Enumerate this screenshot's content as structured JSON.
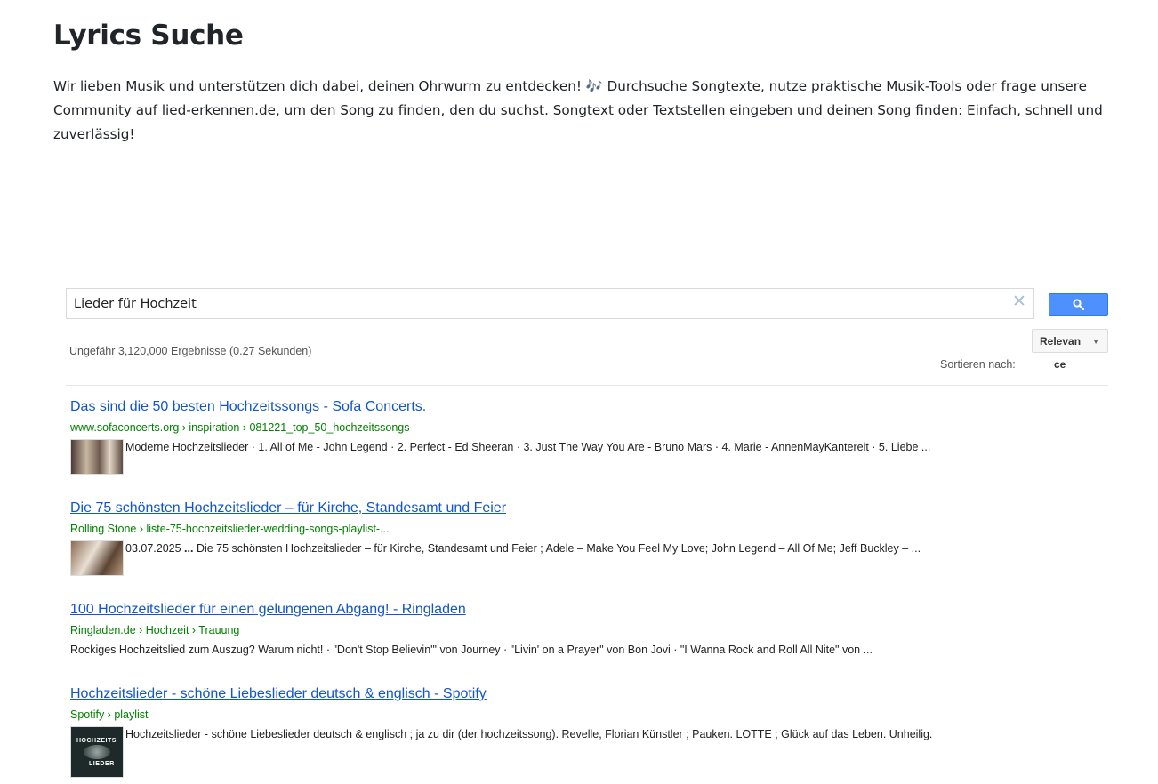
{
  "page": {
    "title": "Lyrics Suche",
    "intro_part1": "Wir lieben Musik und unterstützen dich dabei, deinen Ohrwurm zu entdecken!",
    "intro_icon": "🎶",
    "intro_part2": "Durchsuche Songtexte, nutze praktische Musik-Tools oder frage unsere Community auf lied-erkennen.de, um den Song zu finden, den du suchst. Songtext oder Textstellen eingeben und deinen Song finden: Einfach, schnell und zuverlässig!"
  },
  "search": {
    "query": "Lieder für Hochzeit",
    "clear_icon": "✕",
    "results_count": "Ungefähr 3,120,000 Ergebnisse (0.27 Sekunden)",
    "sort_label": "Sortieren nach:",
    "sort_value": "Relevan",
    "sort_value_overflow": "ce"
  },
  "results": [
    {
      "title": "Das sind die 50 besten Hochzeitssongs - Sofa Concerts.",
      "url": "www.sofaconcerts.org › inspiration › 081221_top_50_hochzeitssongs",
      "snippet": "Moderne Hochzeitslieder · 1. All of Me - John Legend · 2. Perfect - Ed Sheeran · 3. Just The Way You Are - Bruno Mars · 4. Marie - AnnenMayKantereit · 5. Liebe ..."
    },
    {
      "title": "Die 75 schönsten Hochzeitslieder – für Kirche, Standesamt und Feier",
      "url": "Rolling Stone › liste-75-hochzeitslieder-wedding-songs-playlist-...",
      "snippet_date": "03.07.2025",
      "snippet_ellipsis": "...",
      "snippet": "Die 75 schönsten Hochzeitslieder – für Kirche, Standesamt und Feier ; Adele – Make You Feel My Love; John Legend – All Of Me; Jeff Buckley – ..."
    },
    {
      "title": "100 Hochzeitslieder für einen gelungenen Abgang! - Ringladen",
      "url": "Ringladen.de › Hochzeit › Trauung",
      "snippet": "Rockiges Hochzeitslied zum Auszug? Warum nicht! · \"Don't Stop Believin'\" von Journey · \"Livin' on a Prayer\" von Bon Jovi · \"I Wanna Rock and Roll All Nite\" von ..."
    },
    {
      "title": "Hochzeitslieder - schöne Liebeslieder deutsch & englisch - Spotify",
      "url": "Spotify › playlist",
      "thumb_text_top": "HOCHZEITS",
      "thumb_text_bottom": "LIEDER",
      "snippet": "Hochzeitslieder - schöne Liebeslieder deutsch & englisch ; ja zu dir (der hochzeitssong). Revelle, Florian Künstler ; Pauken. LOTTE ; Glück auf das Leben. Unheilig."
    }
  ]
}
